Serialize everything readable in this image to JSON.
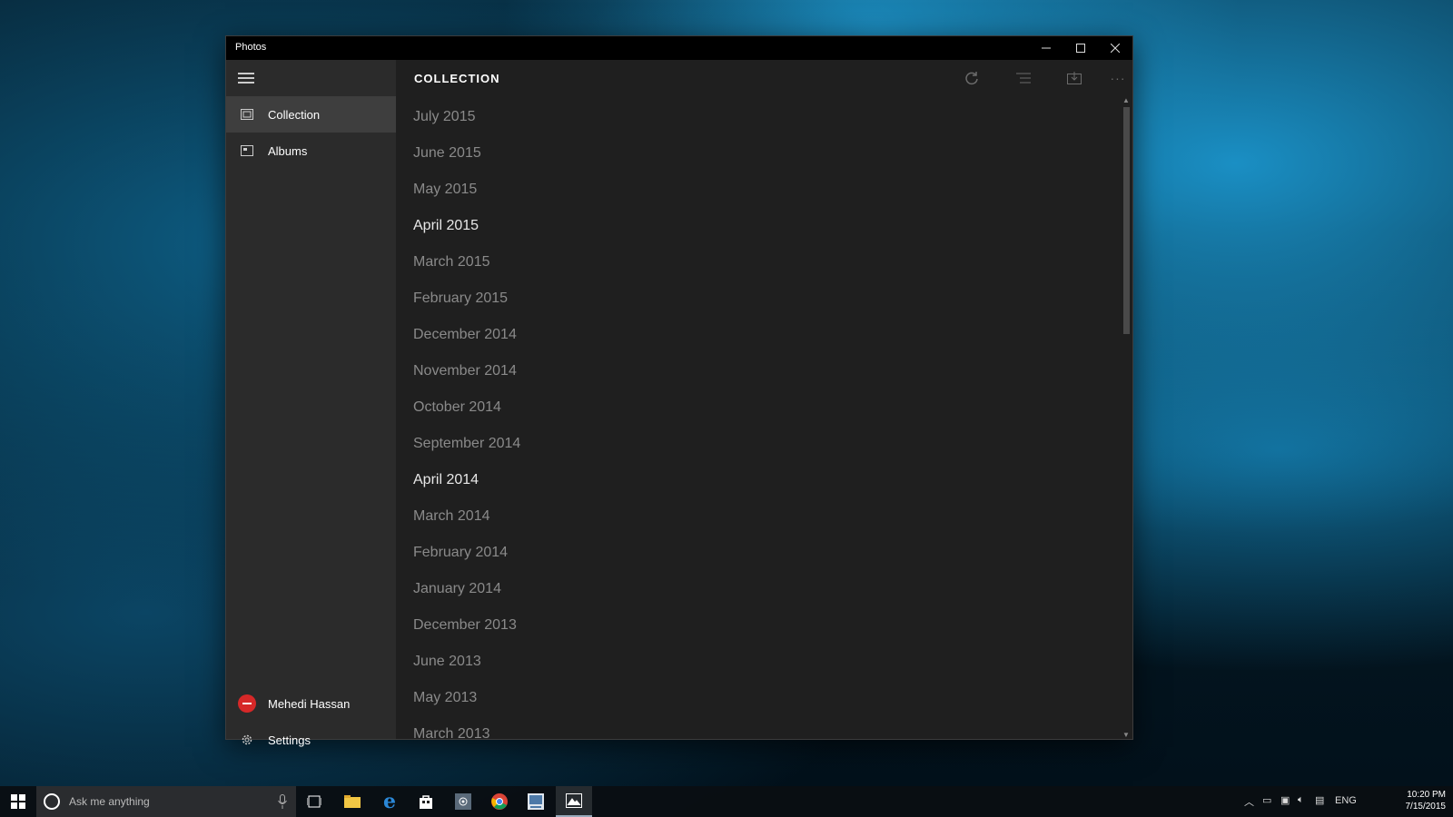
{
  "window": {
    "title": "Photos"
  },
  "sidebar": {
    "items": [
      {
        "label": "Collection",
        "icon": "collection-icon",
        "active": true
      },
      {
        "label": "Albums",
        "icon": "albums-icon",
        "active": false
      }
    ],
    "user": {
      "name": "Mehedi Hassan"
    },
    "settings": {
      "label": "Settings"
    }
  },
  "main": {
    "title": "COLLECTION",
    "months": [
      "July 2015",
      "June 2015",
      "May 2015",
      "April 2015",
      "March 2015",
      "February 2015",
      "December 2014",
      "November 2014",
      "October 2014",
      "September 2014",
      "April 2014",
      "March 2014",
      "February 2014",
      "January 2014",
      "December 2013",
      "June 2013",
      "May 2013",
      "March 2013"
    ],
    "highlighted": [
      "April 2015",
      "April 2014"
    ]
  },
  "taskbar": {
    "search_placeholder": "Ask me anything",
    "language": "ENG",
    "time": "10:20 PM",
    "date": "7/15/2015"
  },
  "colors": {
    "accent_red": "#d62828",
    "window_bg": "#1f1f1f",
    "sidebar_bg": "#2b2b2b"
  }
}
